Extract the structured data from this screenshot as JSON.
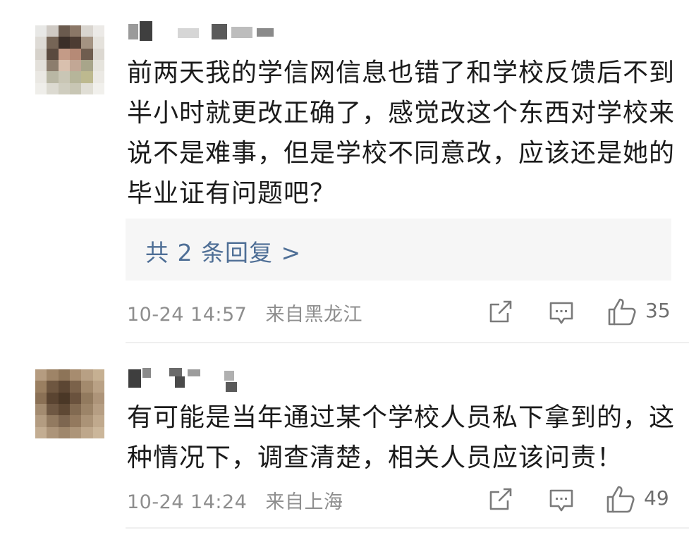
{
  "comments": [
    {
      "text": "前两天我的学信网信息也错了和学校反馈后不到半小时就更改正确了，感觉改这个东西对学校来说不是难事，但是学校不同意改，应该还是她的毕业证有问题吧？",
      "replies_label": "共 2 条回复 >",
      "date": "10-24 14:57",
      "location": "来自黑龙江",
      "likes": "35"
    },
    {
      "text": "有可能是当年通过某个学校人员私下拿到的，这种情况下，调查清楚，相关人员应该问责！",
      "date": "10-24 14:24",
      "location": "来自上海",
      "likes": "49"
    }
  ],
  "icons": {
    "share": "share-icon",
    "comment": "comment-icon",
    "like": "like-icon"
  },
  "colors": {
    "link": "#4f6f96",
    "meta": "#8e8e8e",
    "text": "#1b1b1b",
    "reply_box": "#f6f6f6"
  }
}
